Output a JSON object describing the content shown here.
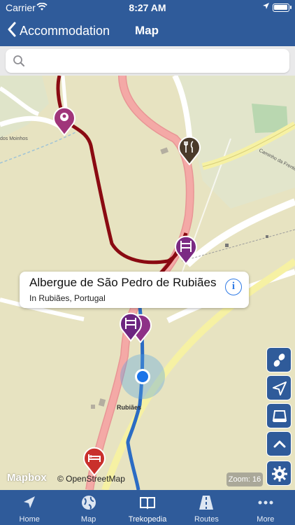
{
  "status_bar": {
    "carrier": "Carrier",
    "time": "8:27 AM",
    "battery_level": 1.0
  },
  "nav": {
    "back_label": "Accommodation",
    "title": "Map"
  },
  "search": {
    "placeholder": "",
    "value": ""
  },
  "map": {
    "callout": {
      "title": "Albergue de São Pedro de Rubiães",
      "subtitle": "In Rubiães, Portugal"
    },
    "place_labels": {
      "rubiaes": "Rubiães",
      "moinhos": "dos Moinhos",
      "caminho": "Caminho da Frente"
    },
    "attribution": {
      "mapbox": "Mapbox",
      "osm": "© OpenStreetMap"
    },
    "zoom_label": "Zoom: 16",
    "side_buttons": [
      "footprints-icon",
      "navigate-icon",
      "road-icon",
      "chevron-up-icon",
      "settings-icon"
    ],
    "pin_colors": {
      "accommodation": "#7b2a83",
      "restaurant": "#4a3a2a",
      "location": "#a0357a",
      "bed": "#c9302c"
    },
    "route_color": "#2b6cc4",
    "trail_color": "#8a0a12"
  },
  "tabs": [
    {
      "label": "Home",
      "icon": "home-arrow-icon",
      "active": false
    },
    {
      "label": "Map",
      "icon": "globe-icon",
      "active": false
    },
    {
      "label": "Trekopedia",
      "icon": "book-icon",
      "active": true
    },
    {
      "label": "Routes",
      "icon": "routes-icon",
      "active": false
    },
    {
      "label": "More",
      "icon": "more-icon",
      "active": false
    }
  ]
}
